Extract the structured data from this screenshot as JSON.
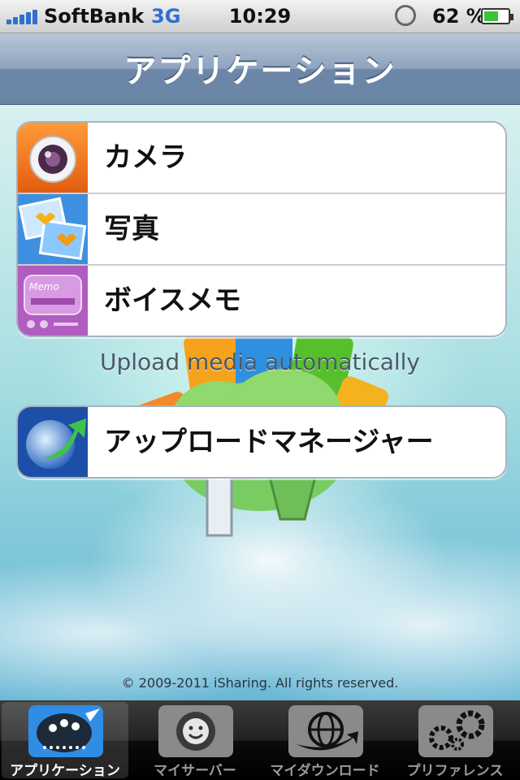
{
  "status_bar": {
    "carrier": "SoftBank",
    "network": "3G",
    "time": "10:29",
    "battery_percent": "62 %",
    "battery_level": 0.62,
    "icons": [
      "signal-icon",
      "rotation-lock-icon",
      "battery-charging-icon"
    ]
  },
  "nav": {
    "title": "アプリケーション"
  },
  "menu": {
    "items": [
      {
        "label": "カメラ",
        "icon": "camera-icon"
      },
      {
        "label": "写真",
        "icon": "photos-icon"
      },
      {
        "label": "ボイスメモ",
        "icon": "voice-memo-icon"
      }
    ],
    "caption": "Upload media automatically",
    "upload_manager": {
      "label": "アップロードマネージャー",
      "icon": "upload-manager-icon"
    }
  },
  "footer": {
    "copyright": "© 2009-2011 iSharing. All rights reserved."
  },
  "tabs": [
    {
      "label": "アプリケーション",
      "icon": "palette-icon",
      "active": true
    },
    {
      "label": "マイサーバー",
      "icon": "network-attached-icon",
      "active": false
    },
    {
      "label": "マイダウンロード",
      "icon": "globe-download-icon",
      "active": false
    },
    {
      "label": "プリファレンス",
      "icon": "gears-icon",
      "active": false
    }
  ],
  "colors": {
    "accent_blue": "#2f6fd0",
    "nav_bar": "#6d87a8",
    "battery_green": "#3bc23b"
  }
}
